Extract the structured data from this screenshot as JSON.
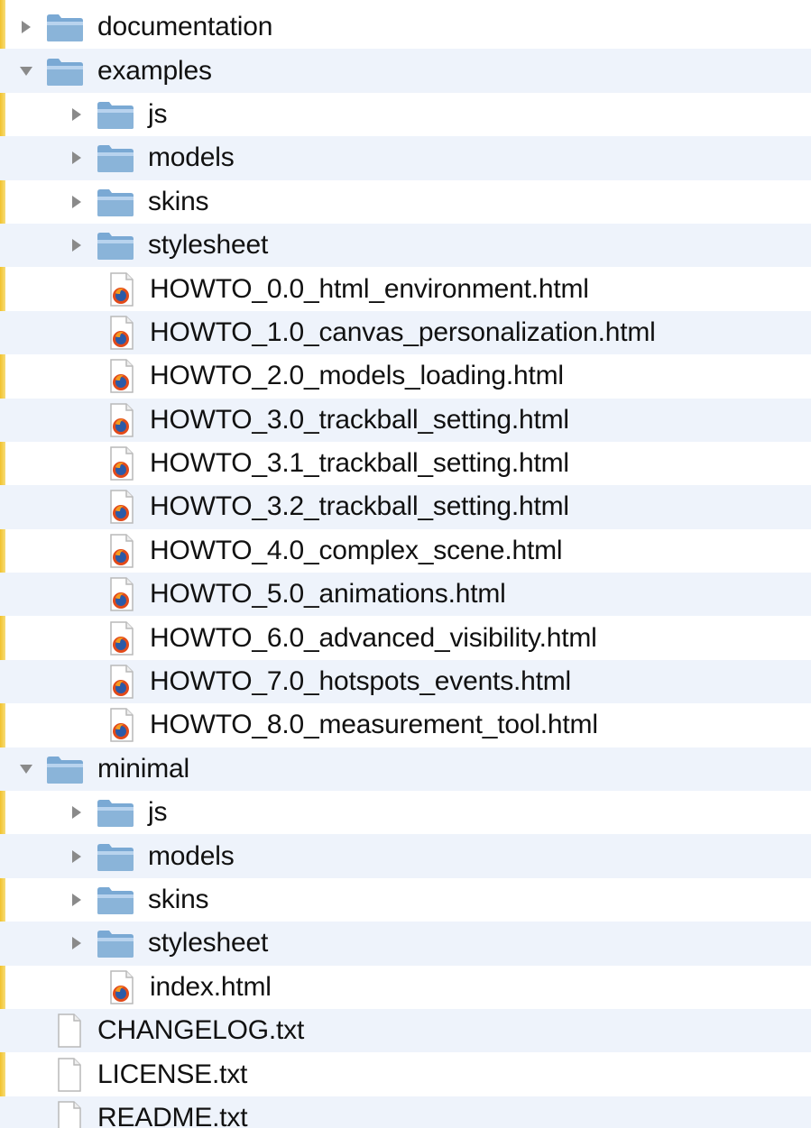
{
  "theme": {
    "row_alt_color": "#eef3fb",
    "folder_color": "#8ab4d9",
    "accent_left_edge": "#f2c22b"
  },
  "tree": [
    {
      "label": "documentation",
      "kind": "folder",
      "level": 0,
      "expanded": false
    },
    {
      "label": "examples",
      "kind": "folder",
      "level": 0,
      "expanded": true
    },
    {
      "label": "js",
      "kind": "folder",
      "level": 1,
      "expanded": false
    },
    {
      "label": "models",
      "kind": "folder",
      "level": 1,
      "expanded": false
    },
    {
      "label": "skins",
      "kind": "folder",
      "level": 1,
      "expanded": false
    },
    {
      "label": "stylesheet",
      "kind": "folder",
      "level": 1,
      "expanded": false
    },
    {
      "label": "HOWTO_0.0_html_environment.html",
      "kind": "html",
      "level": 2
    },
    {
      "label": "HOWTO_1.0_canvas_personalization.html",
      "kind": "html",
      "level": 2
    },
    {
      "label": "HOWTO_2.0_models_loading.html",
      "kind": "html",
      "level": 2
    },
    {
      "label": "HOWTO_3.0_trackball_setting.html",
      "kind": "html",
      "level": 2
    },
    {
      "label": "HOWTO_3.1_trackball_setting.html",
      "kind": "html",
      "level": 2
    },
    {
      "label": "HOWTO_3.2_trackball_setting.html",
      "kind": "html",
      "level": 2
    },
    {
      "label": "HOWTO_4.0_complex_scene.html",
      "kind": "html",
      "level": 2
    },
    {
      "label": "HOWTO_5.0_animations.html",
      "kind": "html",
      "level": 2
    },
    {
      "label": "HOWTO_6.0_advanced_visibility.html",
      "kind": "html",
      "level": 2
    },
    {
      "label": "HOWTO_7.0_hotspots_events.html",
      "kind": "html",
      "level": 2
    },
    {
      "label": "HOWTO_8.0_measurement_tool.html",
      "kind": "html",
      "level": 2
    },
    {
      "label": "minimal",
      "kind": "folder",
      "level": 0,
      "expanded": true
    },
    {
      "label": "js",
      "kind": "folder",
      "level": 1,
      "expanded": false
    },
    {
      "label": "models",
      "kind": "folder",
      "level": 1,
      "expanded": false
    },
    {
      "label": "skins",
      "kind": "folder",
      "level": 1,
      "expanded": false
    },
    {
      "label": "stylesheet",
      "kind": "folder",
      "level": 1,
      "expanded": false
    },
    {
      "label": "index.html",
      "kind": "html",
      "level": 2
    },
    {
      "label": "CHANGELOG.txt",
      "kind": "text",
      "level": 0
    },
    {
      "label": "LICENSE.txt",
      "kind": "text",
      "level": 0
    },
    {
      "label": "README.txt",
      "kind": "text",
      "level": 0
    }
  ]
}
